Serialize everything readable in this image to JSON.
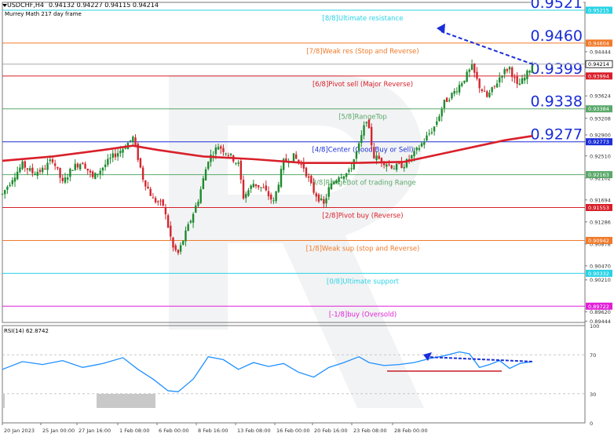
{
  "header": {
    "symbol_line": "USDCHF,H4",
    "ohlc": "0.94132 0.94227 0.94115 0.94214",
    "indicator_name": "Murrey Math 217 day frame"
  },
  "rsi_panel": {
    "title": "RSI(14) 62.8742",
    "axis_labels": [
      "100",
      "70",
      "30",
      "0"
    ],
    "levels": [
      70,
      30
    ]
  },
  "chart_data": {
    "type": "candlestick",
    "symbol": "USDCHF",
    "timeframe": "H4",
    "ylim": [
      0.8942,
      0.9536
    ],
    "y_tick_labels": [
      "0.94444",
      "0.94030",
      "0.93624",
      "0.93208",
      "0.92900",
      "0.92510",
      "0.92102",
      "0.91694",
      "0.91286",
      "0.90878",
      "0.90470",
      "0.90210",
      "0.89620",
      "0.89444"
    ],
    "x_tick_labels": [
      "20 Jan 2023",
      "25 Jan 00:00",
      "27 Jan 16:00",
      "1 Feb 08:00",
      "6 Feb 00:00",
      "8 Feb 16:00",
      "13 Feb 08:00",
      "16 Feb 00:00",
      "20 Feb 16:00",
      "23 Feb 08:00",
      "28 Feb 00:00"
    ],
    "murrey_levels": [
      {
        "price": 0.95215,
        "price_label": "0.95215",
        "name": "[8/8]Ultimate resistance",
        "color": "#29d3e6",
        "big_label": "0.9521"
      },
      {
        "price": 0.94604,
        "price_label": "0.94604",
        "name": "[7/8]Weak res (Stop and Reverse)",
        "color": "#f07a2a",
        "big_label": "0.9460"
      },
      {
        "price": 0.93994,
        "price_label": "0.93994",
        "name": "[6/8]Pivot sell (Major Reverse)",
        "color": "#d8202a",
        "big_label": "0.9399"
      },
      {
        "price": 0.93384,
        "price_label": "0.93384",
        "name": "[5/8]RangeTop",
        "color": "#5aa86a",
        "big_label": "0.9338"
      },
      {
        "price": 0.92773,
        "price_label": "0.92773",
        "name": "[4/8]Center (Good Buy or Sell)",
        "color": "#1a2ed8",
        "big_label": "0.9277"
      },
      {
        "price": 0.92163,
        "price_label": "0.92163",
        "name": "[3/8]RangeBot of trading Range",
        "color": "#5aa86a",
        "big_label": ""
      },
      {
        "price": 0.91553,
        "price_label": "0.91553",
        "name": "[2/8]Pivot buy (Reverse)",
        "color": "#d8202a",
        "big_label": ""
      },
      {
        "price": 0.90942,
        "price_label": "0.90942",
        "name": "[1/8]Weak sup (stop and Reverse)",
        "color": "#f07a2a",
        "big_label": ""
      },
      {
        "price": 0.90332,
        "price_label": "0.90332",
        "name": "[0/8]Ultimate support",
        "color": "#29d3e6",
        "big_label": ""
      },
      {
        "price": 0.89722,
        "price_label": "0.89722",
        "name": "[-1/8]buy (Oversold)",
        "color": "#e020d8",
        "big_label": ""
      }
    ],
    "current_price": {
      "value": 0.94214,
      "label": "0.94214"
    },
    "close_path": [
      [
        0,
        0.918
      ],
      [
        4,
        0.921
      ],
      [
        8,
        0.9235
      ],
      [
        12,
        0.922
      ],
      [
        16,
        0.9225
      ],
      [
        20,
        0.9245
      ],
      [
        24,
        0.92
      ],
      [
        28,
        0.923
      ],
      [
        32,
        0.924
      ],
      [
        36,
        0.921
      ],
      [
        40,
        0.923
      ],
      [
        44,
        0.925
      ],
      [
        48,
        0.9265
      ],
      [
        52,
        0.9285
      ],
      [
        56,
        0.921
      ],
      [
        60,
        0.917
      ],
      [
        64,
        0.916
      ],
      [
        68,
        0.908
      ],
      [
        70,
        0.907
      ],
      [
        74,
        0.912
      ],
      [
        78,
        0.917
      ],
      [
        82,
        0.9245
      ],
      [
        86,
        0.927
      ],
      [
        90,
        0.9255
      ],
      [
        94,
        0.9235
      ],
      [
        96,
        0.9175
      ],
      [
        100,
        0.92
      ],
      [
        104,
        0.919
      ],
      [
        108,
        0.9165
      ],
      [
        112,
        0.924
      ],
      [
        116,
        0.925
      ],
      [
        120,
        0.923
      ],
      [
        124,
        0.9185
      ],
      [
        128,
        0.916
      ],
      [
        130,
        0.919
      ],
      [
        134,
        0.9215
      ],
      [
        138,
        0.922
      ],
      [
        142,
        0.927
      ],
      [
        145,
        0.932
      ],
      [
        148,
        0.925
      ],
      [
        152,
        0.924
      ],
      [
        156,
        0.923
      ],
      [
        160,
        0.9235
      ],
      [
        164,
        0.9255
      ],
      [
        168,
        0.928
      ],
      [
        172,
        0.9305
      ],
      [
        176,
        0.935
      ],
      [
        180,
        0.937
      ],
      [
        184,
        0.9395
      ],
      [
        187,
        0.9415
      ],
      [
        190,
        0.938
      ],
      [
        193,
        0.936
      ],
      [
        196,
        0.938
      ],
      [
        199,
        0.9405
      ],
      [
        202,
        0.9415
      ],
      [
        205,
        0.938
      ],
      [
        208,
        0.9395
      ],
      [
        211,
        0.9421
      ]
    ],
    "moving_average": [
      [
        0,
        0.9242
      ],
      [
        20,
        0.925
      ],
      [
        40,
        0.9262
      ],
      [
        52,
        0.927
      ],
      [
        62,
        0.9262
      ],
      [
        80,
        0.925
      ],
      [
        100,
        0.9245
      ],
      [
        120,
        0.9238
      ],
      [
        140,
        0.9238
      ],
      [
        160,
        0.924
      ],
      [
        175,
        0.9255
      ],
      [
        190,
        0.927
      ],
      [
        200,
        0.928
      ],
      [
        211,
        0.9288
      ]
    ],
    "rsi_path": [
      [
        0,
        55
      ],
      [
        8,
        63
      ],
      [
        16,
        60
      ],
      [
        24,
        64
      ],
      [
        32,
        57
      ],
      [
        40,
        61
      ],
      [
        48,
        67
      ],
      [
        54,
        55
      ],
      [
        60,
        45
      ],
      [
        66,
        33
      ],
      [
        70,
        32
      ],
      [
        76,
        45
      ],
      [
        82,
        68
      ],
      [
        88,
        65
      ],
      [
        94,
        55
      ],
      [
        100,
        62
      ],
      [
        106,
        58
      ],
      [
        112,
        61
      ],
      [
        118,
        52
      ],
      [
        124,
        47
      ],
      [
        130,
        57
      ],
      [
        136,
        62
      ],
      [
        142,
        68
      ],
      [
        146,
        62
      ],
      [
        152,
        59
      ],
      [
        158,
        60
      ],
      [
        164,
        62
      ],
      [
        170,
        66
      ],
      [
        176,
        69
      ],
      [
        182,
        73
      ],
      [
        186,
        71
      ],
      [
        190,
        57
      ],
      [
        194,
        60
      ],
      [
        198,
        64
      ],
      [
        202,
        56
      ],
      [
        206,
        61
      ],
      [
        211,
        63
      ]
    ]
  }
}
